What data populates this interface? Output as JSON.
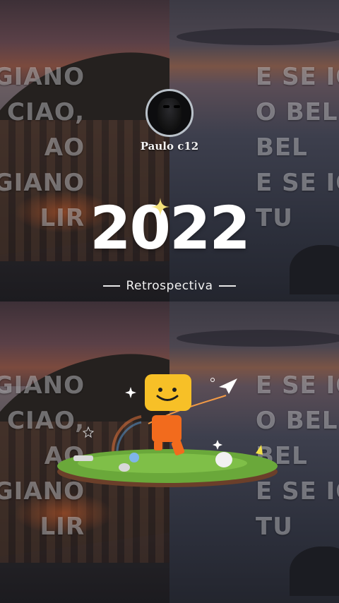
{
  "profile": {
    "name": "Paulo c12"
  },
  "hero": {
    "year": "2022",
    "subtitle": "Retrospectiva"
  },
  "lyrics": {
    "left_top": [
      "GIANO",
      "CIAO,",
      "AO",
      "GIANO",
      "LIR"
    ],
    "right_top": [
      "E SE IO",
      "O BEL",
      "BEL",
      "E SE IO",
      "TU"
    ],
    "left_bottom": [
      "GIANO",
      "CIAO,",
      "AO",
      "GIANO",
      "LIR"
    ],
    "right_bottom": [
      "E SE IO",
      "O BEL",
      "BEL",
      "E SE IO",
      "TU"
    ]
  },
  "icons": {
    "sparkle": "sparkle-icon",
    "paper_plane": "paper-plane-icon",
    "mascot": "smiling-box-mascot"
  },
  "colors": {
    "mascot_head": "#f7c027",
    "mascot_body": "#f26b1d",
    "grass": "#6aa83a",
    "soil": "#6b3f2a"
  }
}
